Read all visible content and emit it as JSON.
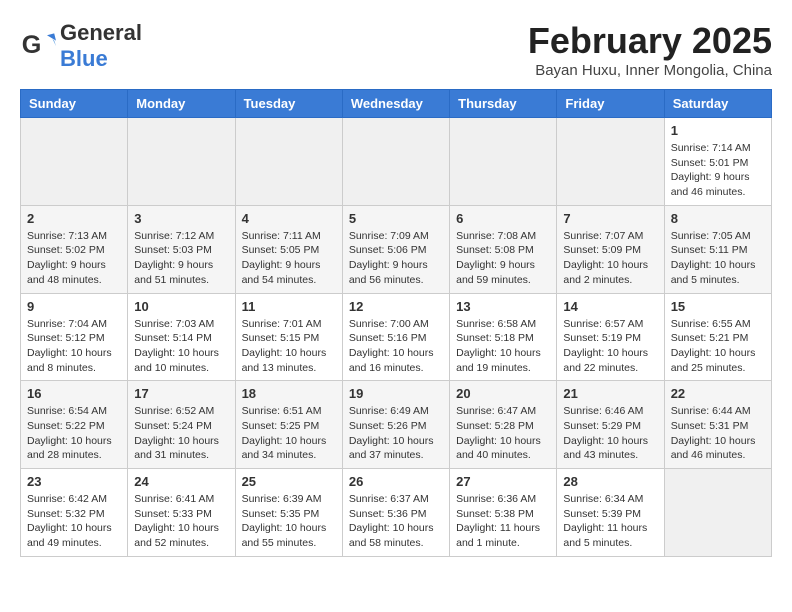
{
  "header": {
    "logo_general": "General",
    "logo_blue": "Blue",
    "month": "February 2025",
    "location": "Bayan Huxu, Inner Mongolia, China"
  },
  "weekdays": [
    "Sunday",
    "Monday",
    "Tuesday",
    "Wednesday",
    "Thursday",
    "Friday",
    "Saturday"
  ],
  "weeks": [
    [
      {
        "day": "",
        "info": ""
      },
      {
        "day": "",
        "info": ""
      },
      {
        "day": "",
        "info": ""
      },
      {
        "day": "",
        "info": ""
      },
      {
        "day": "",
        "info": ""
      },
      {
        "day": "",
        "info": ""
      },
      {
        "day": "1",
        "info": "Sunrise: 7:14 AM\nSunset: 5:01 PM\nDaylight: 9 hours and 46 minutes."
      }
    ],
    [
      {
        "day": "2",
        "info": "Sunrise: 7:13 AM\nSunset: 5:02 PM\nDaylight: 9 hours and 48 minutes."
      },
      {
        "day": "3",
        "info": "Sunrise: 7:12 AM\nSunset: 5:03 PM\nDaylight: 9 hours and 51 minutes."
      },
      {
        "day": "4",
        "info": "Sunrise: 7:11 AM\nSunset: 5:05 PM\nDaylight: 9 hours and 54 minutes."
      },
      {
        "day": "5",
        "info": "Sunrise: 7:09 AM\nSunset: 5:06 PM\nDaylight: 9 hours and 56 minutes."
      },
      {
        "day": "6",
        "info": "Sunrise: 7:08 AM\nSunset: 5:08 PM\nDaylight: 9 hours and 59 minutes."
      },
      {
        "day": "7",
        "info": "Sunrise: 7:07 AM\nSunset: 5:09 PM\nDaylight: 10 hours and 2 minutes."
      },
      {
        "day": "8",
        "info": "Sunrise: 7:05 AM\nSunset: 5:11 PM\nDaylight: 10 hours and 5 minutes."
      }
    ],
    [
      {
        "day": "9",
        "info": "Sunrise: 7:04 AM\nSunset: 5:12 PM\nDaylight: 10 hours and 8 minutes."
      },
      {
        "day": "10",
        "info": "Sunrise: 7:03 AM\nSunset: 5:14 PM\nDaylight: 10 hours and 10 minutes."
      },
      {
        "day": "11",
        "info": "Sunrise: 7:01 AM\nSunset: 5:15 PM\nDaylight: 10 hours and 13 minutes."
      },
      {
        "day": "12",
        "info": "Sunrise: 7:00 AM\nSunset: 5:16 PM\nDaylight: 10 hours and 16 minutes."
      },
      {
        "day": "13",
        "info": "Sunrise: 6:58 AM\nSunset: 5:18 PM\nDaylight: 10 hours and 19 minutes."
      },
      {
        "day": "14",
        "info": "Sunrise: 6:57 AM\nSunset: 5:19 PM\nDaylight: 10 hours and 22 minutes."
      },
      {
        "day": "15",
        "info": "Sunrise: 6:55 AM\nSunset: 5:21 PM\nDaylight: 10 hours and 25 minutes."
      }
    ],
    [
      {
        "day": "16",
        "info": "Sunrise: 6:54 AM\nSunset: 5:22 PM\nDaylight: 10 hours and 28 minutes."
      },
      {
        "day": "17",
        "info": "Sunrise: 6:52 AM\nSunset: 5:24 PM\nDaylight: 10 hours and 31 minutes."
      },
      {
        "day": "18",
        "info": "Sunrise: 6:51 AM\nSunset: 5:25 PM\nDaylight: 10 hours and 34 minutes."
      },
      {
        "day": "19",
        "info": "Sunrise: 6:49 AM\nSunset: 5:26 PM\nDaylight: 10 hours and 37 minutes."
      },
      {
        "day": "20",
        "info": "Sunrise: 6:47 AM\nSunset: 5:28 PM\nDaylight: 10 hours and 40 minutes."
      },
      {
        "day": "21",
        "info": "Sunrise: 6:46 AM\nSunset: 5:29 PM\nDaylight: 10 hours and 43 minutes."
      },
      {
        "day": "22",
        "info": "Sunrise: 6:44 AM\nSunset: 5:31 PM\nDaylight: 10 hours and 46 minutes."
      }
    ],
    [
      {
        "day": "23",
        "info": "Sunrise: 6:42 AM\nSunset: 5:32 PM\nDaylight: 10 hours and 49 minutes."
      },
      {
        "day": "24",
        "info": "Sunrise: 6:41 AM\nSunset: 5:33 PM\nDaylight: 10 hours and 52 minutes."
      },
      {
        "day": "25",
        "info": "Sunrise: 6:39 AM\nSunset: 5:35 PM\nDaylight: 10 hours and 55 minutes."
      },
      {
        "day": "26",
        "info": "Sunrise: 6:37 AM\nSunset: 5:36 PM\nDaylight: 10 hours and 58 minutes."
      },
      {
        "day": "27",
        "info": "Sunrise: 6:36 AM\nSunset: 5:38 PM\nDaylight: 11 hours and 1 minute."
      },
      {
        "day": "28",
        "info": "Sunrise: 6:34 AM\nSunset: 5:39 PM\nDaylight: 11 hours and 5 minutes."
      },
      {
        "day": "",
        "info": ""
      }
    ]
  ]
}
